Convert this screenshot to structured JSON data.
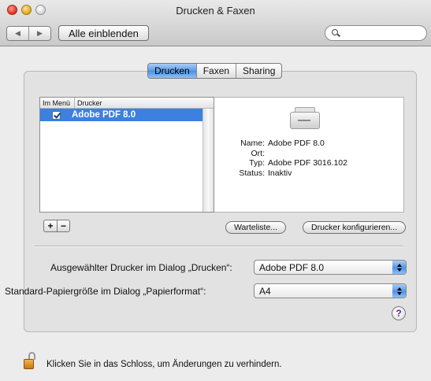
{
  "window": {
    "title": "Drucken & Faxen"
  },
  "toolbar": {
    "show_all_label": "Alle einblenden",
    "search_placeholder": ""
  },
  "tabs": [
    {
      "label": "Drucken",
      "active": true
    },
    {
      "label": "Faxen",
      "active": false
    },
    {
      "label": "Sharing",
      "active": false
    }
  ],
  "printer_list": {
    "col_menu": "Im Menü",
    "col_printer": "Drucker",
    "rows": [
      {
        "in_menu": true,
        "name": "Adobe PDF 8.0",
        "selected": true
      }
    ]
  },
  "details": {
    "name_label": "Name:",
    "name_value": "Adobe PDF 8.0",
    "ort_label": "Ort:",
    "ort_value": "",
    "typ_label": "Typ:",
    "typ_value": "Adobe PDF 3016.102",
    "status_label": "Status:",
    "status_value": "Inaktiv"
  },
  "buttons": {
    "add": "+",
    "remove": "−",
    "queue": "Warteliste...",
    "configure": "Drucker konfigurieren..."
  },
  "selected_printer": {
    "label": "Ausgewählter Drucker im Dialog „Drucken“:",
    "value": "Adobe PDF 8.0"
  },
  "paper_size": {
    "label": "Standard-Papiergröße im Dialog „Papierformat“:",
    "value": "A4"
  },
  "help": "?",
  "lock_text": "Klicken Sie in das Schloss, um Änderungen zu verhindern."
}
